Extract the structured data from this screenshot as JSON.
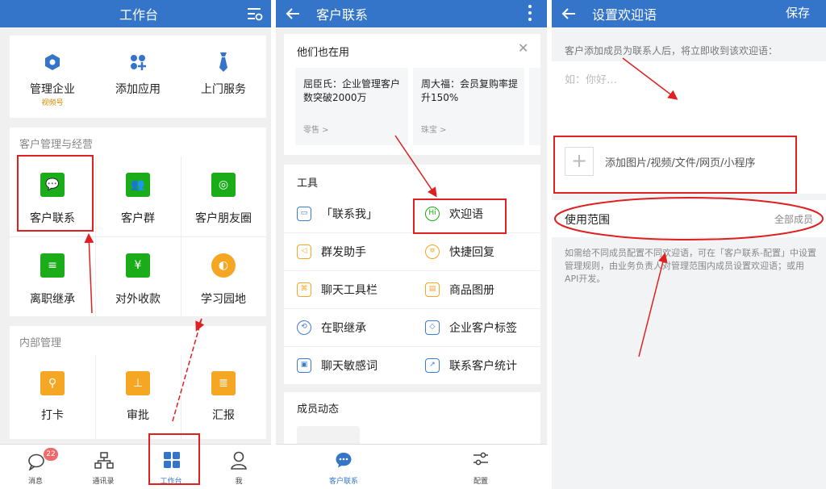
{
  "panel1": {
    "title": "工作台",
    "top_apps": [
      {
        "label": "管理企业",
        "sub": "视频号",
        "icon": "hexagon-icon",
        "color": "#3475c9"
      },
      {
        "label": "添加应用",
        "icon": "add-app-icon",
        "color": "#3475c9"
      },
      {
        "label": "上门服务",
        "icon": "tie-icon",
        "color": "#3475c9"
      }
    ],
    "section1_title": "客户管理与经营",
    "section1_apps": [
      {
        "label": "客户联系",
        "glyph": "💬",
        "color": "#1aad19"
      },
      {
        "label": "客户群",
        "glyph": "👥",
        "color": "#1aad19"
      },
      {
        "label": "客户朋友圈",
        "glyph": "◎",
        "color": "#1aad19"
      },
      {
        "label": "离职继承",
        "glyph": "≡",
        "color": "#1aad19"
      },
      {
        "label": "对外收款",
        "glyph": "¥",
        "color": "#1aad19"
      },
      {
        "label": "学习园地",
        "glyph": "◐",
        "color": "#f5a623"
      }
    ],
    "section2_title": "内部管理",
    "section2_apps": [
      {
        "label": "打卡",
        "glyph": "⚲",
        "color": "#f5a623"
      },
      {
        "label": "审批",
        "glyph": "⊥",
        "color": "#f5a623"
      },
      {
        "label": "汇报",
        "glyph": "≣",
        "color": "#f5a623"
      }
    ],
    "tabs": [
      {
        "label": "消息",
        "badge": "22"
      },
      {
        "label": "通讯录"
      },
      {
        "label": "工作台"
      },
      {
        "label": "我"
      }
    ]
  },
  "panel2": {
    "title": "客户联系",
    "also_using_title": "他们也在用",
    "cases": [
      {
        "text": "屈臣氏：企业管理客户数突破2000万",
        "tag": "零售 >"
      },
      {
        "text": "周大福：会员复购率提升150%",
        "tag": "珠宝 >"
      }
    ],
    "tools_title": "工具",
    "tools": [
      {
        "label": "「联系我」",
        "glyph": "▭"
      },
      {
        "label": "欢迎语",
        "glyph": "Hi"
      },
      {
        "label": "群发助手",
        "glyph": "◁"
      },
      {
        "label": "快捷回复",
        "glyph": "≡"
      },
      {
        "label": "聊天工具栏",
        "glyph": "⌘"
      },
      {
        "label": "商品图册",
        "glyph": "▤"
      },
      {
        "label": "在职继承",
        "glyph": "⟲"
      },
      {
        "label": "企业客户标签",
        "glyph": "◇"
      },
      {
        "label": "聊天敏感词",
        "glyph": "▣"
      },
      {
        "label": "联系客户统计",
        "glyph": "↗"
      }
    ],
    "member_title": "成员动态",
    "tabs": [
      {
        "label": "客户联系"
      },
      {
        "label": "配置"
      }
    ]
  },
  "panel3": {
    "title": "设置欢迎语",
    "save": "保存",
    "hint": "客户添加成员为联系人后，将立即收到该欢迎语：",
    "placeholder": "如：你好…",
    "attach": "添加图片/视频/文件/网页/小程序",
    "scope_label": "使用范围",
    "scope_value": "全部成员",
    "note": "如需给不同成员配置不同欢迎语，可在「客户联系-配置」中设置管理规则，由业务负责人对管理范围内成员设置欢迎语；或用API开发。"
  },
  "colors": {
    "accent": "#3475c9",
    "green": "#1aad19",
    "orange": "#f5a623",
    "annotation": "#e02020"
  }
}
